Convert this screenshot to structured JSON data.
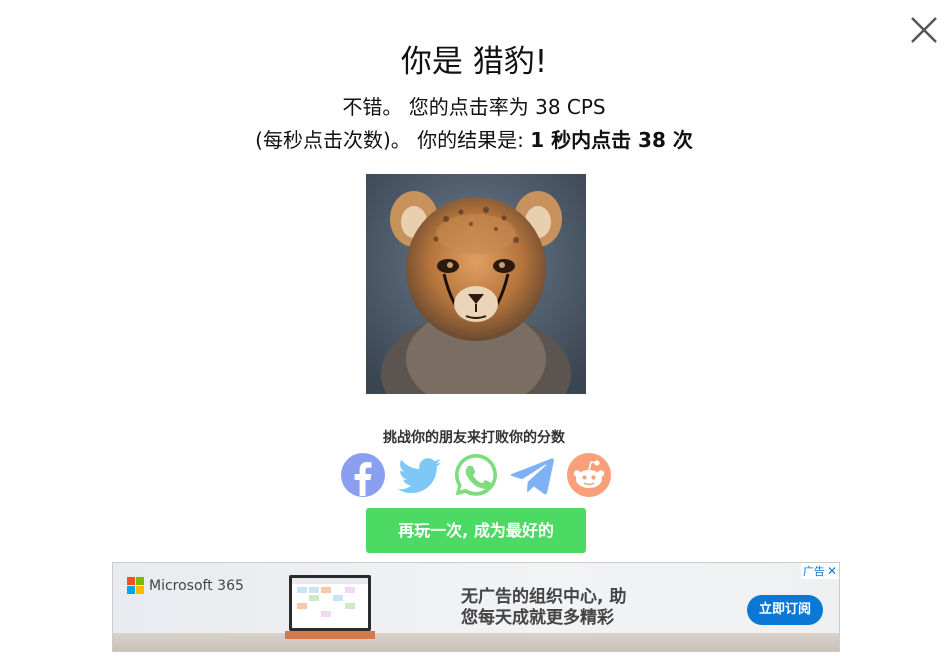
{
  "result": {
    "title": "你是 猎豹!",
    "line1": "不错。 您的点击率为 38 CPS",
    "line2_plain": "(每秒点击次数)。 你的结果是:",
    "line2_bold": "1 秒内点击 38 次"
  },
  "challenge": {
    "text": "挑战你的朋友来打败你的分数"
  },
  "share": {
    "icons": [
      "facebook-icon",
      "twitter-icon",
      "whatsapp-icon",
      "telegram-icon",
      "reddit-icon"
    ],
    "colors": {
      "facebook": "#8b9ff0",
      "twitter": "#7ec7f7",
      "whatsapp": "#7ddc7e",
      "telegram": "#7fb2f5",
      "reddit": "#f9a07a"
    }
  },
  "replay": {
    "label": "再玩一次, 成为最好的",
    "color": "#4cd964"
  },
  "ad": {
    "brand": "Microsoft 365",
    "headline_line1": "无广告的组织中心, 助",
    "headline_line2": "您每天成就更多精彩",
    "cta": "立即订阅",
    "tag": "广告",
    "close": "✕"
  }
}
